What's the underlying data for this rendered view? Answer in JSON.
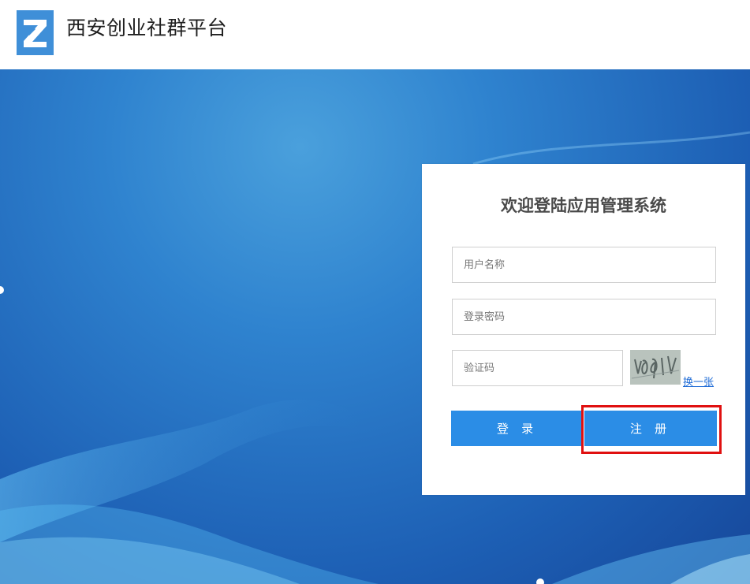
{
  "header": {
    "site_title": "西安创业社群平台",
    "logo_icon": "z-logo-icon"
  },
  "login_card": {
    "title": "欢迎登陆应用管理系统",
    "username_placeholder": "用户名称",
    "password_placeholder": "登录密码",
    "captcha_placeholder": "验证码",
    "captcha_refresh_label": "换一张",
    "login_button_label": "登 录",
    "register_button_label": "注 册"
  },
  "colors": {
    "brand_blue": "#2b8de6",
    "highlight_red": "#e01010",
    "link_blue": "#1e6bd6"
  }
}
